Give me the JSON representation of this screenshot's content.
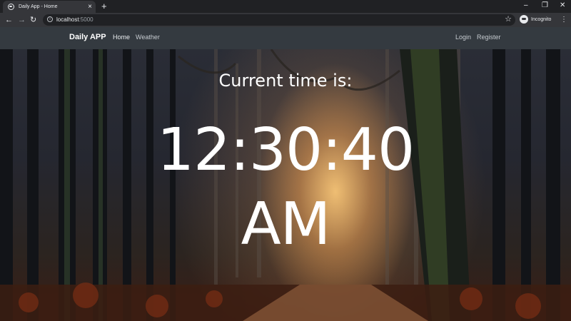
{
  "browser": {
    "tab_title": "Daily App - Home",
    "url_host": "localhost",
    "url_port": ":5000",
    "profile_label": "Incognito",
    "icons": {
      "favicon": "globe-icon",
      "tab_close": "close-icon",
      "new_tab": "plus-icon",
      "back": "arrow-left-icon",
      "forward": "arrow-right-icon",
      "reload": "reload-icon",
      "info": "info-icon",
      "bookmark": "star-icon",
      "menu": "kebab-menu-icon"
    }
  },
  "navbar": {
    "brand": "Daily APP",
    "links": [
      "Home",
      "Weather"
    ],
    "right_links": [
      "Login",
      "Register"
    ],
    "background": "#343a40"
  },
  "hero": {
    "label": "Current time is:",
    "time_line1": "12:30:40",
    "time_line2": "AM",
    "text_color": "#ffffff"
  }
}
